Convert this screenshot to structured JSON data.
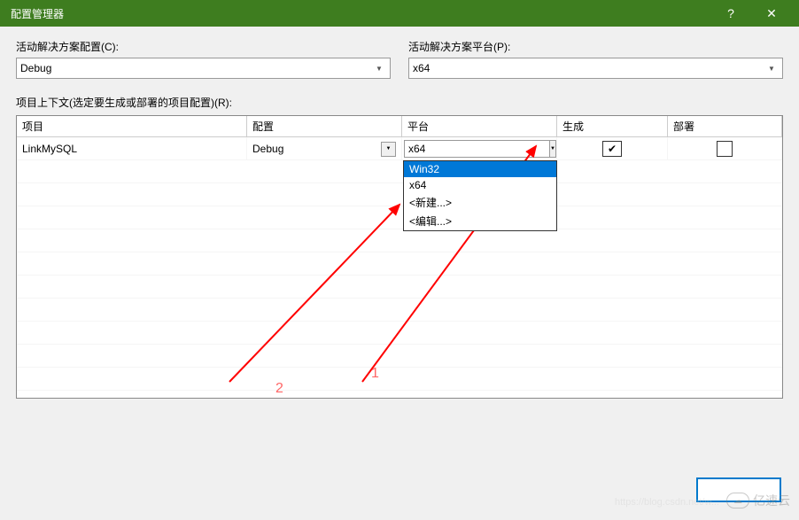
{
  "titlebar": {
    "title": "配置管理器",
    "help": "?",
    "close": "✕"
  },
  "top": {
    "config_label": "活动解决方案配置(C):",
    "config_value": "Debug",
    "platform_label": "活动解决方案平台(P):",
    "platform_value": "x64"
  },
  "context_label": "项目上下文(选定要生成或部署的项目配置)(R):",
  "headers": {
    "project": "项目",
    "config": "配置",
    "platform": "平台",
    "build": "生成",
    "deploy": "部署"
  },
  "row": {
    "project": "LinkMySQL",
    "config": "Debug",
    "platform": "x64"
  },
  "dropdown": {
    "items": [
      "Win32",
      "x64",
      "<新建...>",
      "<编辑...>"
    ],
    "selected": 0
  },
  "annotations": {
    "label1": "1",
    "label2": "2"
  },
  "checkmark": "✔",
  "watermark": {
    "brand": "亿速云",
    "url": "https://blog.csdn.net/w..."
  }
}
